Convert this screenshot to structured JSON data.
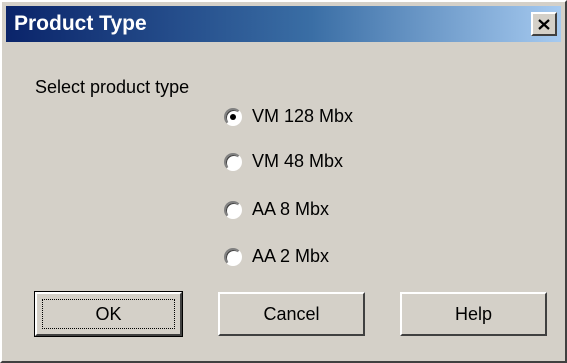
{
  "window": {
    "title": "Product Type",
    "close_icon": "close-x-icon"
  },
  "dialog": {
    "prompt": "Select product type",
    "options": [
      {
        "label": "VM 128 Mbx",
        "selected": true
      },
      {
        "label": "VM 48 Mbx",
        "selected": false
      },
      {
        "label": "AA 8 Mbx",
        "selected": false
      },
      {
        "label": "AA 2 Mbx",
        "selected": false
      }
    ]
  },
  "buttons": {
    "ok": "OK",
    "cancel": "Cancel",
    "help": "Help"
  },
  "colors": {
    "titlebar_start": "#0a246a",
    "titlebar_end": "#a6caf0",
    "face": "#d4d0c8"
  }
}
